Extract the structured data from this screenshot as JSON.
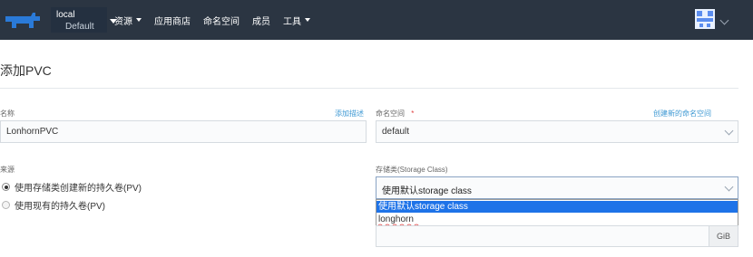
{
  "topbar": {
    "cluster": {
      "name": "local",
      "project": "Default"
    },
    "nav": [
      {
        "label": "资源",
        "has_caret": true
      },
      {
        "label": "应用商店",
        "has_caret": false
      },
      {
        "label": "命名空间",
        "has_caret": false
      },
      {
        "label": "成员",
        "has_caret": false
      },
      {
        "label": "工具",
        "has_caret": true
      }
    ]
  },
  "page": {
    "title": "添加PVC"
  },
  "form": {
    "name": {
      "label": "名称",
      "link": "添加描述",
      "value": "LonhornPVC"
    },
    "namespace": {
      "label": "命名空间",
      "required_mark": "*",
      "link": "创建新的命名空间",
      "value": "default"
    },
    "source": {
      "label": "来源",
      "options": [
        {
          "label": "使用存储类创建新的持久卷(PV)",
          "checked": true
        },
        {
          "label": "使用现有的持久卷(PV)",
          "checked": false
        }
      ]
    },
    "storage_class": {
      "label": "存储类(Storage Class)",
      "value": "使用默认storage class",
      "options": [
        "使用默认storage class",
        "longhorn"
      ]
    },
    "capacity": {
      "value": "",
      "unit": "GiB"
    }
  },
  "colors": {
    "topbar": "#2b3542",
    "link": "#3d98d3",
    "selected_option": "#1e73e8",
    "required": "#e03e3e"
  }
}
